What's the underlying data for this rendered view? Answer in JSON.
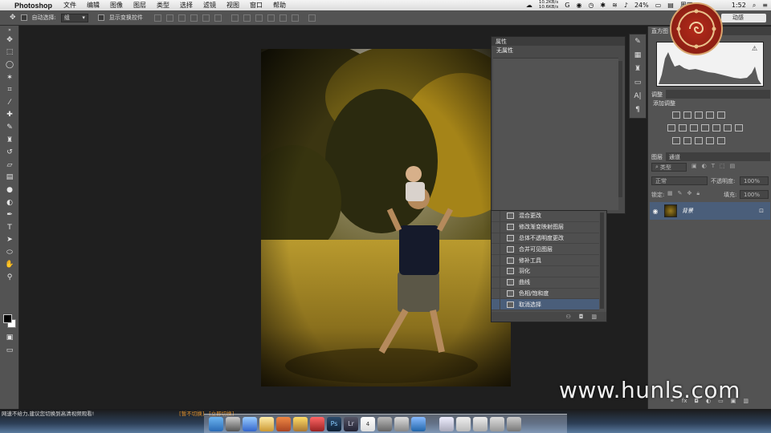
{
  "menubar": {
    "app_name": "Photoshop",
    "items": [
      "文件",
      "编辑",
      "图像",
      "图层",
      "类型",
      "选择",
      "滤镜",
      "视图",
      "窗口",
      "帮助"
    ],
    "net_up": "10.2KB/s",
    "net_down": "10.6KB/s",
    "battery": "24%",
    "clock_partial": "周四",
    "time_partial": "1:52"
  },
  "options_bar": {
    "auto_select_label": "自动选择:",
    "auto_select_value": "组",
    "show_transform_label": "显示变换控件",
    "workspace": "动感"
  },
  "properties_panel": {
    "tab": "属性",
    "content_title": "无属性"
  },
  "history_panel": {
    "items": [
      {
        "label": "混合更改",
        "active": false
      },
      {
        "label": "修改渐变映射图层",
        "active": false
      },
      {
        "label": "总体不透明度更改",
        "active": false
      },
      {
        "label": "合并可见图层",
        "active": false
      },
      {
        "label": "修补工具",
        "active": false
      },
      {
        "label": "羽化",
        "active": false
      },
      {
        "label": "曲线",
        "active": false
      },
      {
        "label": "色相/饱和度",
        "active": false
      },
      {
        "label": "取消选择",
        "active": true
      }
    ]
  },
  "histogram_panel": {
    "tab": "直方图"
  },
  "adjustments_panel": {
    "tab": "调整",
    "subtitle": "添加调整"
  },
  "layers_panel": {
    "tabs": [
      "图层",
      "通道"
    ],
    "filter_label": "类型",
    "blend_mode": "正常",
    "opacity_label": "不透明度:",
    "opacity_value": "100%",
    "lock_label": "锁定:",
    "fill_label": "填充:",
    "fill_value": "100%",
    "layer_name": "背景"
  },
  "watermark": "www.hunls.com",
  "bottom_message": {
    "text": "网速不给力,建议您切换到高清视频观看!",
    "option1": "[暂不切换]",
    "option2": "[立即切换]"
  },
  "colors": {
    "panel_bg": "#535353",
    "canvas_bg": "#1f1f1f",
    "selection": "#4a5e7a",
    "accent_orange": "#e3922c"
  }
}
